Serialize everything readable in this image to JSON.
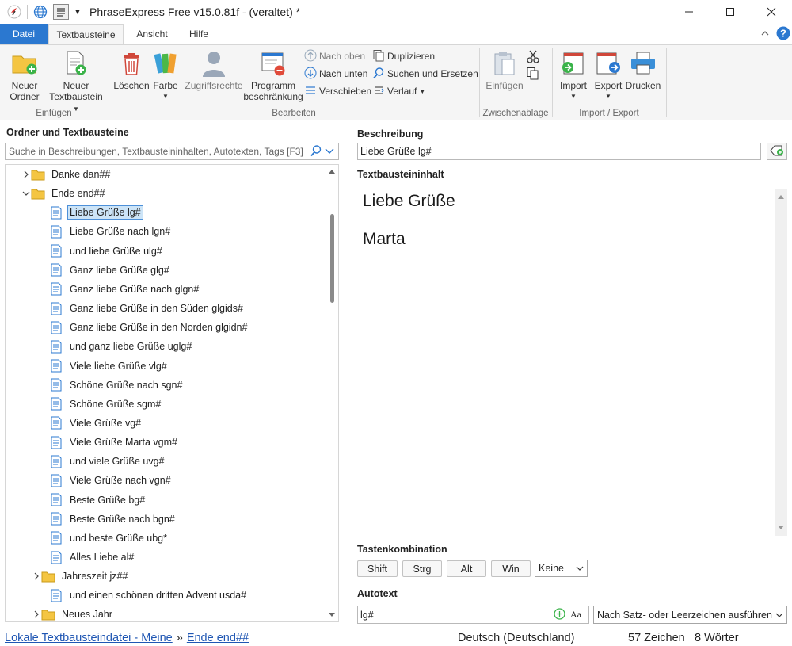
{
  "window": {
    "title": "PhraseExpress Free v15.0.81f - (veraltet) *"
  },
  "tabs": [
    {
      "label": "Datei"
    },
    {
      "label": "Textbausteine"
    },
    {
      "label": "Ansicht"
    },
    {
      "label": "Hilfe"
    }
  ],
  "ribbon": {
    "einfuegen_group": {
      "label": "Einfügen",
      "new_folder": "Neuer\nOrdner",
      "new_folder_l1": "Neuer",
      "new_folder_l2": "Ordner",
      "new_phrase_l1": "Neuer",
      "new_phrase_l2": "Textbaustein"
    },
    "bearbeiten_group": {
      "label": "Bearbeiten",
      "delete": "Löschen",
      "color": "Farbe",
      "access": "Zugriffsrechte",
      "restrict_l1": "Programm",
      "restrict_l2": "beschränkung",
      "move_up": "Nach oben",
      "move_down": "Nach unten",
      "move": "Verschieben",
      "duplicate": "Duplizieren",
      "search_replace": "Suchen und Ersetzen",
      "history": "Verlauf"
    },
    "clipboard_group": {
      "label": "Zwischenablage",
      "paste": "Einfügen"
    },
    "importexport_group": {
      "label": "Import / Export",
      "import": "Import",
      "export": "Export",
      "print": "Drucken"
    }
  },
  "left_panel": {
    "heading": "Ordner und Textbausteine",
    "search_placeholder": "Suche in Beschreibungen, Textbausteininhalten, Autotexten, Tags [F3]",
    "tree": [
      {
        "label": "Danke dan##",
        "type": "folder",
        "level": 1,
        "expanded": false
      },
      {
        "label": "Ende end##",
        "type": "folder",
        "level": 1,
        "expanded": true
      },
      {
        "label": "Liebe Grüße lg#",
        "type": "phrase",
        "level": 2,
        "selected": true
      },
      {
        "label": "Liebe Grüße nach lgn#",
        "type": "phrase",
        "level": 2
      },
      {
        "label": "und liebe Grüße ulg#",
        "type": "phrase",
        "level": 2
      },
      {
        "label": "Ganz liebe Grüße glg#",
        "type": "phrase",
        "level": 2
      },
      {
        "label": "Ganz liebe Grüße nach glgn#",
        "type": "phrase",
        "level": 2
      },
      {
        "label": "Ganz liebe Grüße in den Süden glgids#",
        "type": "phrase",
        "level": 2
      },
      {
        "label": "Ganz liebe Grüße in den Norden glgidn#",
        "type": "phrase",
        "level": 2
      },
      {
        "label": "und ganz liebe Grüße uglg#",
        "type": "phrase",
        "level": 2
      },
      {
        "label": "Viele liebe Grüße vlg#",
        "type": "phrase",
        "level": 2
      },
      {
        "label": "Schöne Grüße nach sgn#",
        "type": "phrase",
        "level": 2
      },
      {
        "label": "Schöne Grüße sgm#",
        "type": "phrase",
        "level": 2
      },
      {
        "label": "Viele Grüße vg#",
        "type": "phrase",
        "level": 2
      },
      {
        "label": "Viele Grüße Marta vgm#",
        "type": "phrase",
        "level": 2
      },
      {
        "label": "und viele Grüße uvg#",
        "type": "phrase",
        "level": 2
      },
      {
        "label": "Viele Grüße nach vgn#",
        "type": "phrase",
        "level": 2
      },
      {
        "label": "Beste Grüße bg#",
        "type": "phrase",
        "level": 2
      },
      {
        "label": "Beste Grüße nach bgn#",
        "type": "phrase",
        "level": 2
      },
      {
        "label": "und beste Grüße  ubg*",
        "type": "phrase",
        "level": 2
      },
      {
        "label": "Alles Liebe al#",
        "type": "phrase",
        "level": 2
      },
      {
        "label": "Jahreszeit jz##",
        "type": "folder",
        "level": 2,
        "expanded": false
      },
      {
        "label": "und einen schönen dritten Advent usda#",
        "type": "phrase",
        "level": 2
      },
      {
        "label": "Neues Jahr",
        "type": "folder",
        "level": 2,
        "expanded": false
      }
    ]
  },
  "right_panel": {
    "description_label": "Beschreibung",
    "description_value": "Liebe Grüße lg#",
    "content_label": "Textbausteininhalt",
    "content_lines": [
      "Liebe Grüße",
      "Marta"
    ],
    "hotkey_label": "Tastenkombination",
    "hotkey_buttons": [
      "Shift",
      "Strg",
      "Alt",
      "Win"
    ],
    "hotkey_key": "Keine",
    "autotext_label": "Autotext",
    "autotext_value": "lg#",
    "autotext_mode": "Nach Satz- oder Leerzeichen ausführen"
  },
  "status": {
    "breadcrumb_root": "Lokale Textbausteindatei - Meine",
    "breadcrumb_sep": "»",
    "breadcrumb_folder": "Ende end##",
    "language": "Deutsch (Deutschland)",
    "chars": "57 Zeichen",
    "words": "8 Wörter"
  },
  "colors": {
    "accent": "#2b78d0",
    "folder": "#f4c542",
    "link": "#1f56b3"
  }
}
